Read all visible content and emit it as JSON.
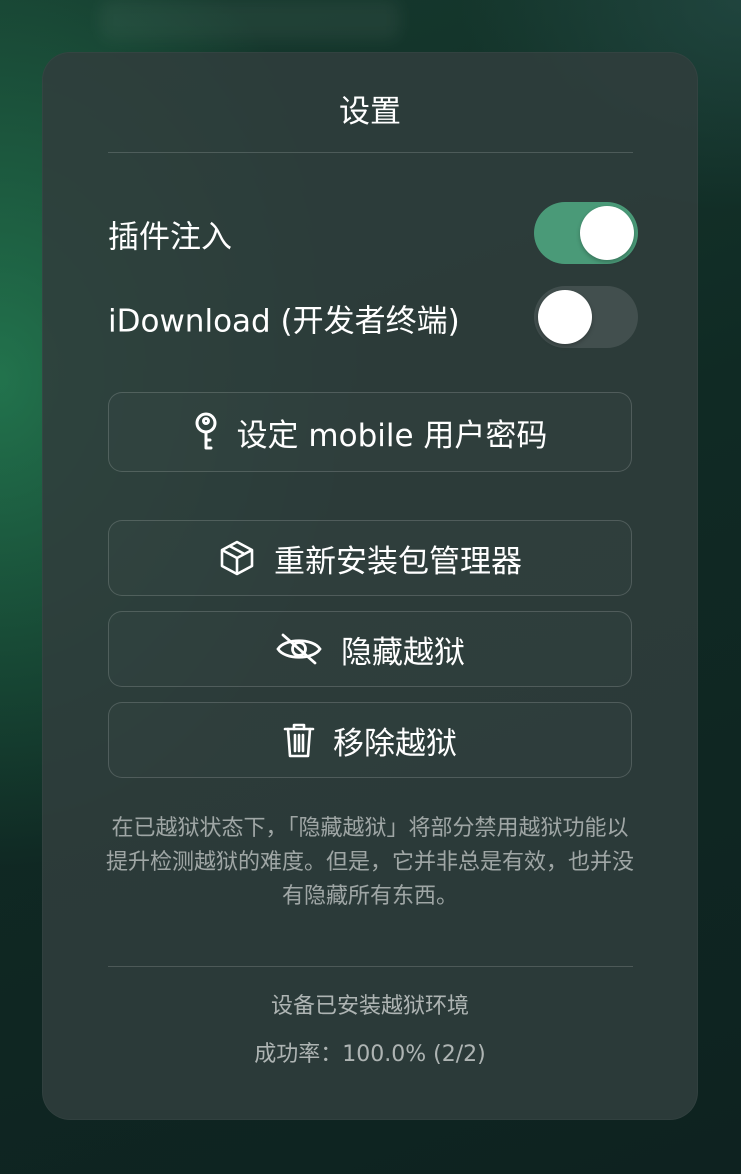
{
  "panel": {
    "title": "设置"
  },
  "toggles": [
    {
      "label": "插件注入",
      "state": "on"
    },
    {
      "label": "iDownload (开发者终端)",
      "state": "off"
    }
  ],
  "buttons": {
    "set_password": {
      "label": "设定 mobile 用户密码",
      "icon": "key-icon"
    },
    "reinstall_package_manager": {
      "label": "重新安装包管理器",
      "icon": "package-box-icon"
    },
    "hide_jailbreak": {
      "label": "隐藏越狱",
      "icon": "eye-slash-icon"
    },
    "remove_jailbreak": {
      "label": "移除越狱",
      "icon": "trash-icon"
    }
  },
  "note": "在已越狱状态下，「隐藏越狱」将部分禁用越狱功能以提升检测越狱的难度。但是，它并非总是有效，也并没有隐藏所有东西。",
  "status": {
    "environment": "设备已安装越狱环境",
    "success_rate": "成功率：100.0% (2/2)"
  },
  "colors": {
    "toggle_on": "#4a9a78",
    "toggle_off": "#465452",
    "panel_bg": "#303e3c"
  }
}
